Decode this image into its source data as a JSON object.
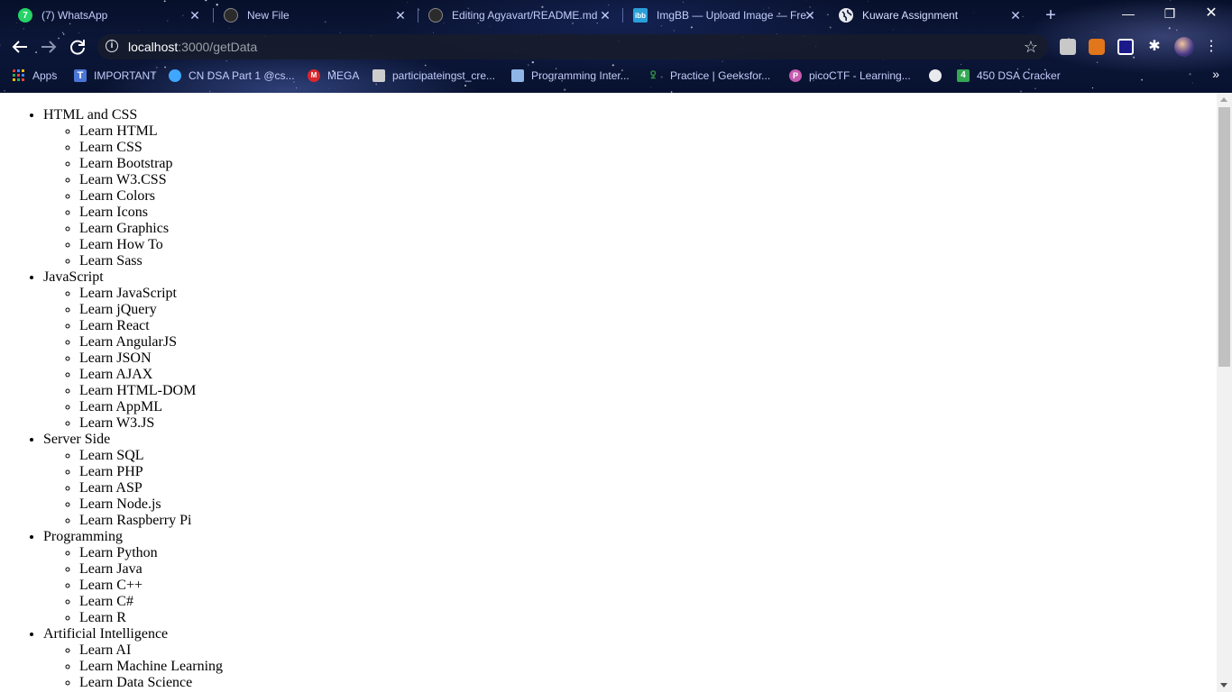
{
  "browser": {
    "tabs": [
      {
        "title": "(7) WhatsApp",
        "favicon": "whatsapp-icon",
        "color": "#25d366"
      },
      {
        "title": "New File",
        "favicon": "github-icon",
        "color": "#2b2b2b"
      },
      {
        "title": "Editing Agyavart/README.md",
        "favicon": "github-icon",
        "color": "#2b2b2b"
      },
      {
        "title": "ImgBB — Upload Image — Free",
        "favicon": "imgbb-icon",
        "color": "#2a9fd8"
      },
      {
        "title": "Kuware Assignment",
        "favicon": "globe-icon",
        "color": "#e8eaed"
      }
    ],
    "address": {
      "host": "localhost",
      "path": ":3000/getData"
    },
    "bookmarks": [
      {
        "label": "Apps",
        "icon": "apps-grid-icon",
        "color": "#ea4335"
      },
      {
        "label": "IMPORTANT",
        "icon": "typora-icon",
        "color": "#4a76d8"
      },
      {
        "label": "CN DSA Part 1 @cs...",
        "icon": "codingninjas-icon",
        "color": "#3fa7ff"
      },
      {
        "label": "MEGA",
        "icon": "mega-icon",
        "color": "#d9272e"
      },
      {
        "label": "participateingst_cre...",
        "icon": "document-icon",
        "color": "#cccccc"
      },
      {
        "label": "Programming Inter...",
        "icon": "layers-icon",
        "color": "#8fb4e6"
      },
      {
        "label": "Practice | Geeksfor...",
        "icon": "geeksforgeeks-icon",
        "color": "#2f8d46"
      },
      {
        "label": "picoCTF - Learning...",
        "icon": "picoctf-icon",
        "color": "#c65bb0"
      },
      {
        "label": "",
        "icon": "globe-icon",
        "color": "#e8eaed"
      },
      {
        "label": "450 DSA Cracker",
        "icon": "number-four-icon",
        "color": "#34a853"
      }
    ]
  },
  "categories": [
    {
      "name": "HTML and CSS",
      "items": [
        "Learn HTML",
        "Learn CSS",
        "Learn Bootstrap",
        "Learn W3.CSS",
        "Learn Colors",
        "Learn Icons",
        "Learn Graphics",
        "Learn How To",
        "Learn Sass"
      ]
    },
    {
      "name": "JavaScript",
      "items": [
        "Learn JavaScript",
        "Learn jQuery",
        "Learn React",
        "Learn AngularJS",
        "Learn JSON",
        "Learn AJAX",
        "Learn HTML-DOM",
        "Learn AppML",
        "Learn W3.JS"
      ]
    },
    {
      "name": "Server Side",
      "items": [
        "Learn SQL",
        "Learn PHP",
        "Learn ASP",
        "Learn Node.js",
        "Learn Raspberry Pi"
      ]
    },
    {
      "name": "Programming",
      "items": [
        "Learn Python",
        "Learn Java",
        "Learn C++",
        "Learn C#",
        "Learn R"
      ]
    },
    {
      "name": "Artificial Intelligence",
      "items": [
        "Learn AI",
        "Learn Machine Learning",
        "Learn Data Science"
      ]
    }
  ]
}
